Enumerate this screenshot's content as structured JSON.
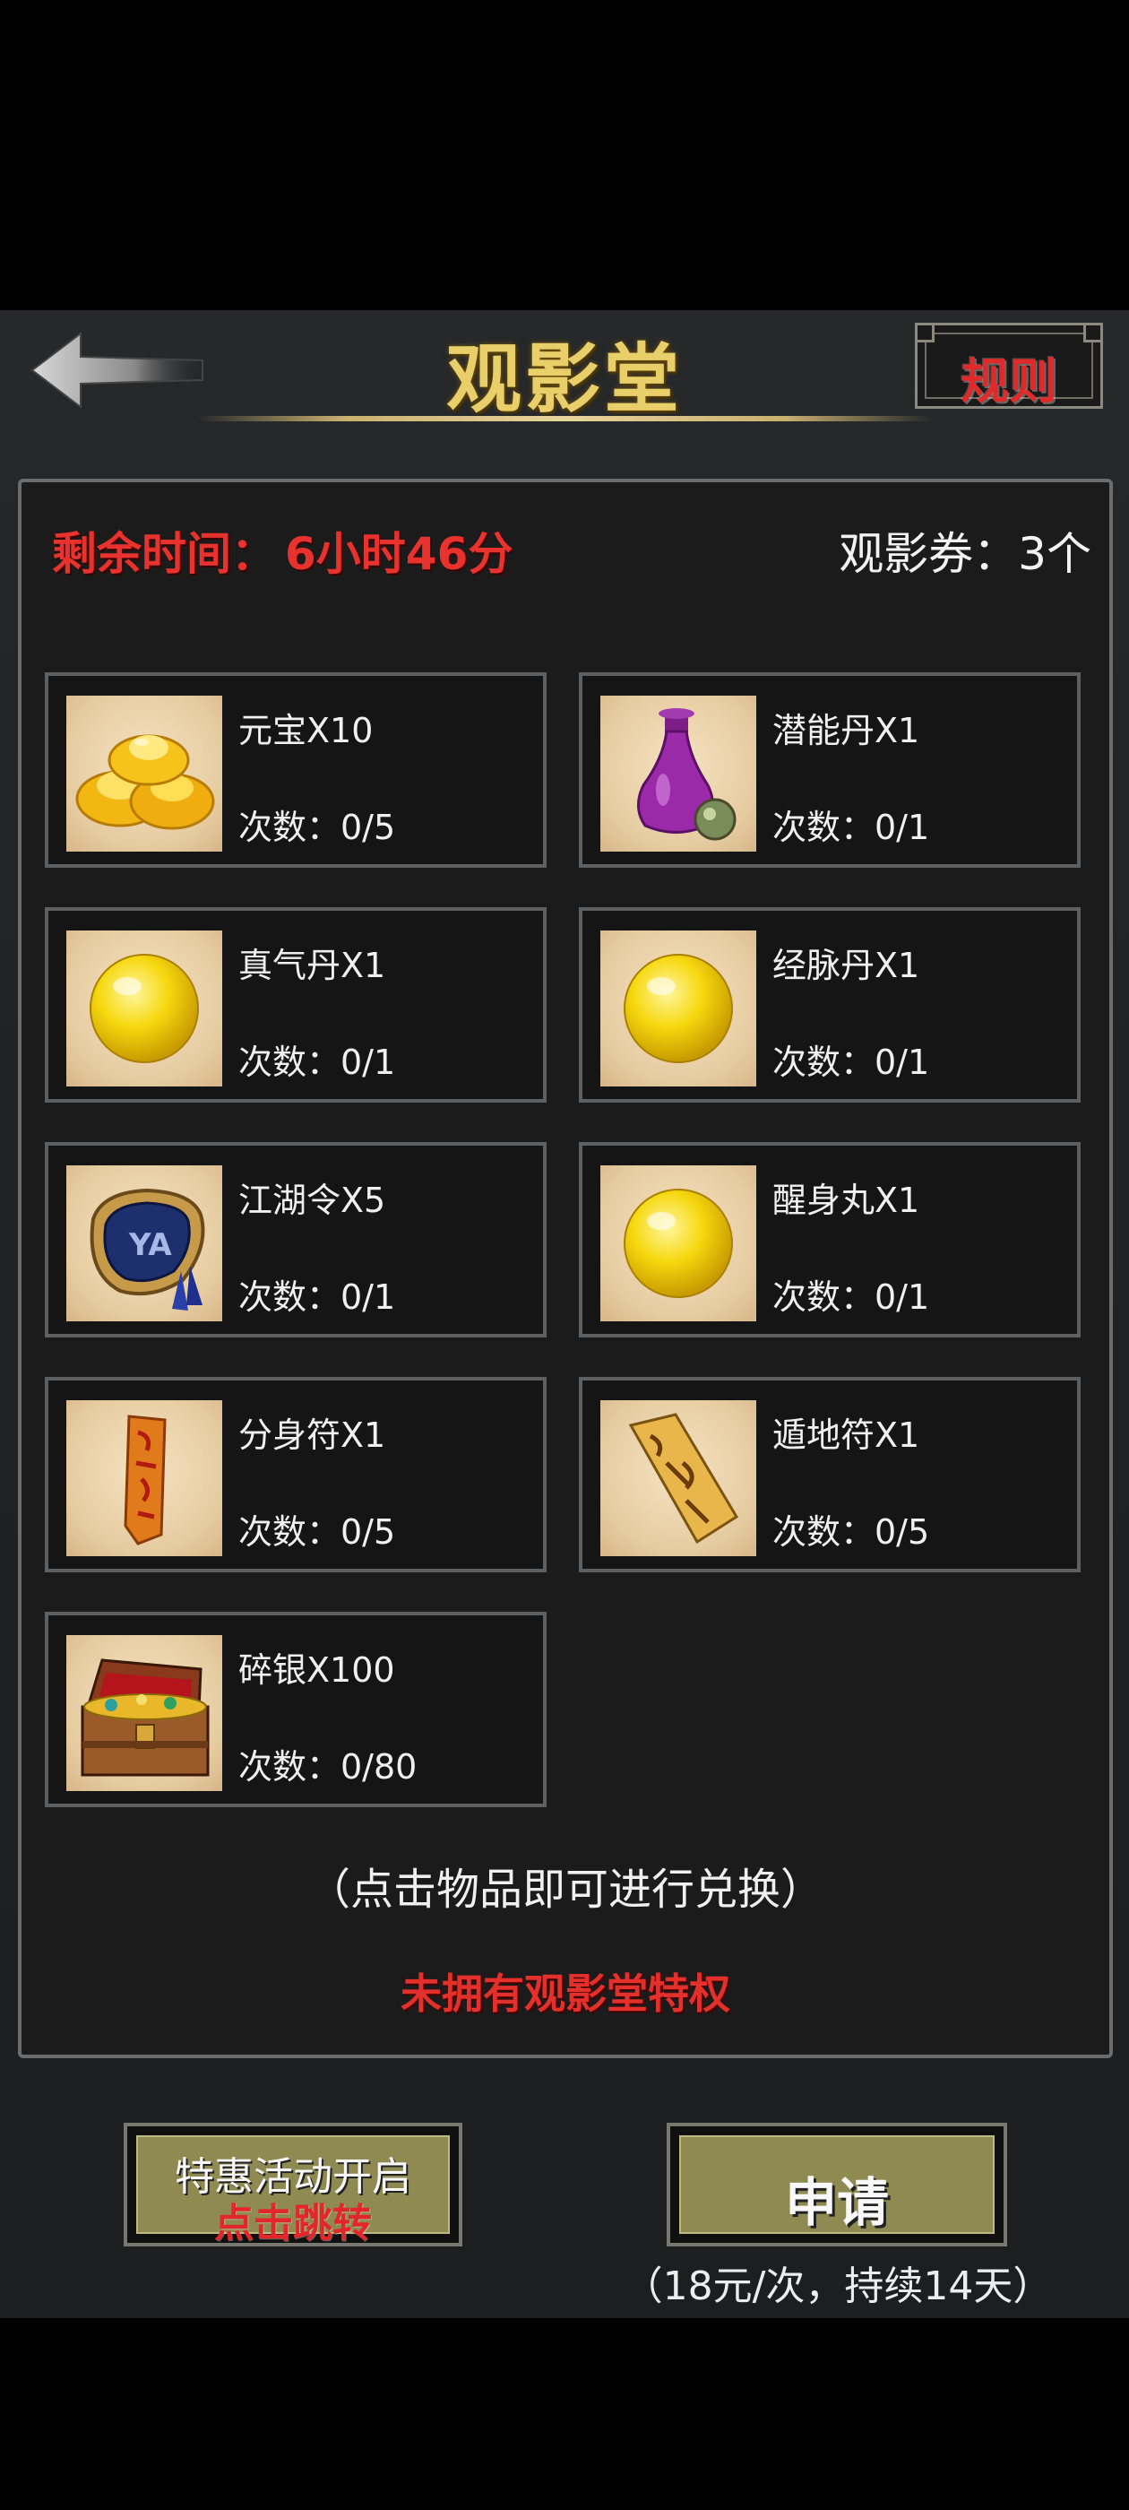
{
  "header": {
    "title": "观影堂",
    "rules_label": "规则"
  },
  "status": {
    "remaining_label": "剩余时间：",
    "remaining_value": "6小时46分",
    "tickets_label": "观影券：3个"
  },
  "items": [
    {
      "name": "元宝X10",
      "count": "次数：0/5",
      "icon": "gold-ingots-icon"
    },
    {
      "name": "潜能丹X1",
      "count": "次数：0/1",
      "icon": "purple-vase-icon"
    },
    {
      "name": "真气丹X1",
      "count": "次数：0/1",
      "icon": "yellow-pill-icon"
    },
    {
      "name": "经脉丹X1",
      "count": "次数：0/1",
      "icon": "yellow-pill-icon"
    },
    {
      "name": "江湖令X5",
      "count": "次数：0/1",
      "icon": "token-pouch-icon"
    },
    {
      "name": "醒身丸X1",
      "count": "次数：0/1",
      "icon": "yellow-pill-icon"
    },
    {
      "name": "分身符X1",
      "count": "次数：0/5",
      "icon": "red-talisman-icon"
    },
    {
      "name": "遁地符X1",
      "count": "次数：0/5",
      "icon": "yellow-talisman-icon"
    },
    {
      "name": "碎银X100",
      "count": "次数：0/80",
      "icon": "treasure-chest-icon"
    }
  ],
  "hint": "（点击物品即可进行兑换）",
  "no_privilege": "未拥有观影堂特权",
  "promo": {
    "line1": "特惠活动开启",
    "line2": "点击跳转"
  },
  "apply": {
    "label": "申请",
    "note": "（18元/次，持续14天）"
  }
}
